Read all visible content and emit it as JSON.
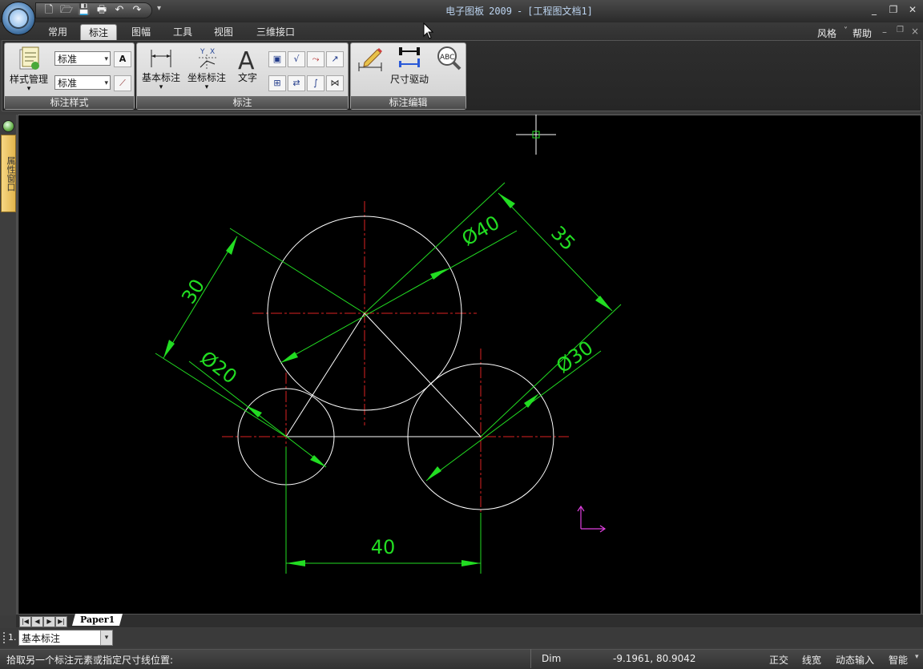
{
  "app": {
    "title_name": "电子图板",
    "title_version": "2009",
    "title_sep": "-",
    "document": "[工程图文档1]"
  },
  "qat_icons": [
    "new-file-icon",
    "open-folder-icon",
    "save-icon",
    "print-icon",
    "undo-icon",
    "redo-icon"
  ],
  "tabs": [
    "常用",
    "标注",
    "图幅",
    "工具",
    "视图",
    "三维接口"
  ],
  "active_tab": "标注",
  "right_menu": {
    "style": "风格",
    "style_arrow": "˅",
    "help": "帮助"
  },
  "ribbon": {
    "style_group": {
      "label": "标注样式",
      "style_manager": "样式管理",
      "combo1": "标准",
      "combo2": "标准"
    },
    "dim_group": {
      "label": "标注",
      "basic_dim": "基本标注",
      "coord_dim": "坐标标注",
      "text": "文字"
    },
    "edit_group": {
      "label": "标注编辑",
      "dim_drive": "尺寸驱动"
    }
  },
  "sidebar": {
    "panel_label": "属性窗口"
  },
  "drawing": {
    "dim_d40": "Ø40",
    "dim_35": "35",
    "dim_30": "30",
    "dim_d20": "Ø20",
    "dim_d30": "Ø30",
    "dim_40": "40"
  },
  "layout_tab": "Paper1",
  "command": {
    "index": "1.",
    "current": "基本标注"
  },
  "status": {
    "prompt": "拾取另一个标注元素或指定尺寸线位置:",
    "mode": "Dim",
    "coords": "-9.1961, 80.9042",
    "toggles": [
      "正交",
      "线宽",
      "动态输入",
      "智能"
    ]
  },
  "colors": {
    "dimension": "#22dd22",
    "centerline": "#dd2222",
    "geometry": "#ffffff",
    "ucs_icon": "#e040e0",
    "background": "#000000"
  }
}
